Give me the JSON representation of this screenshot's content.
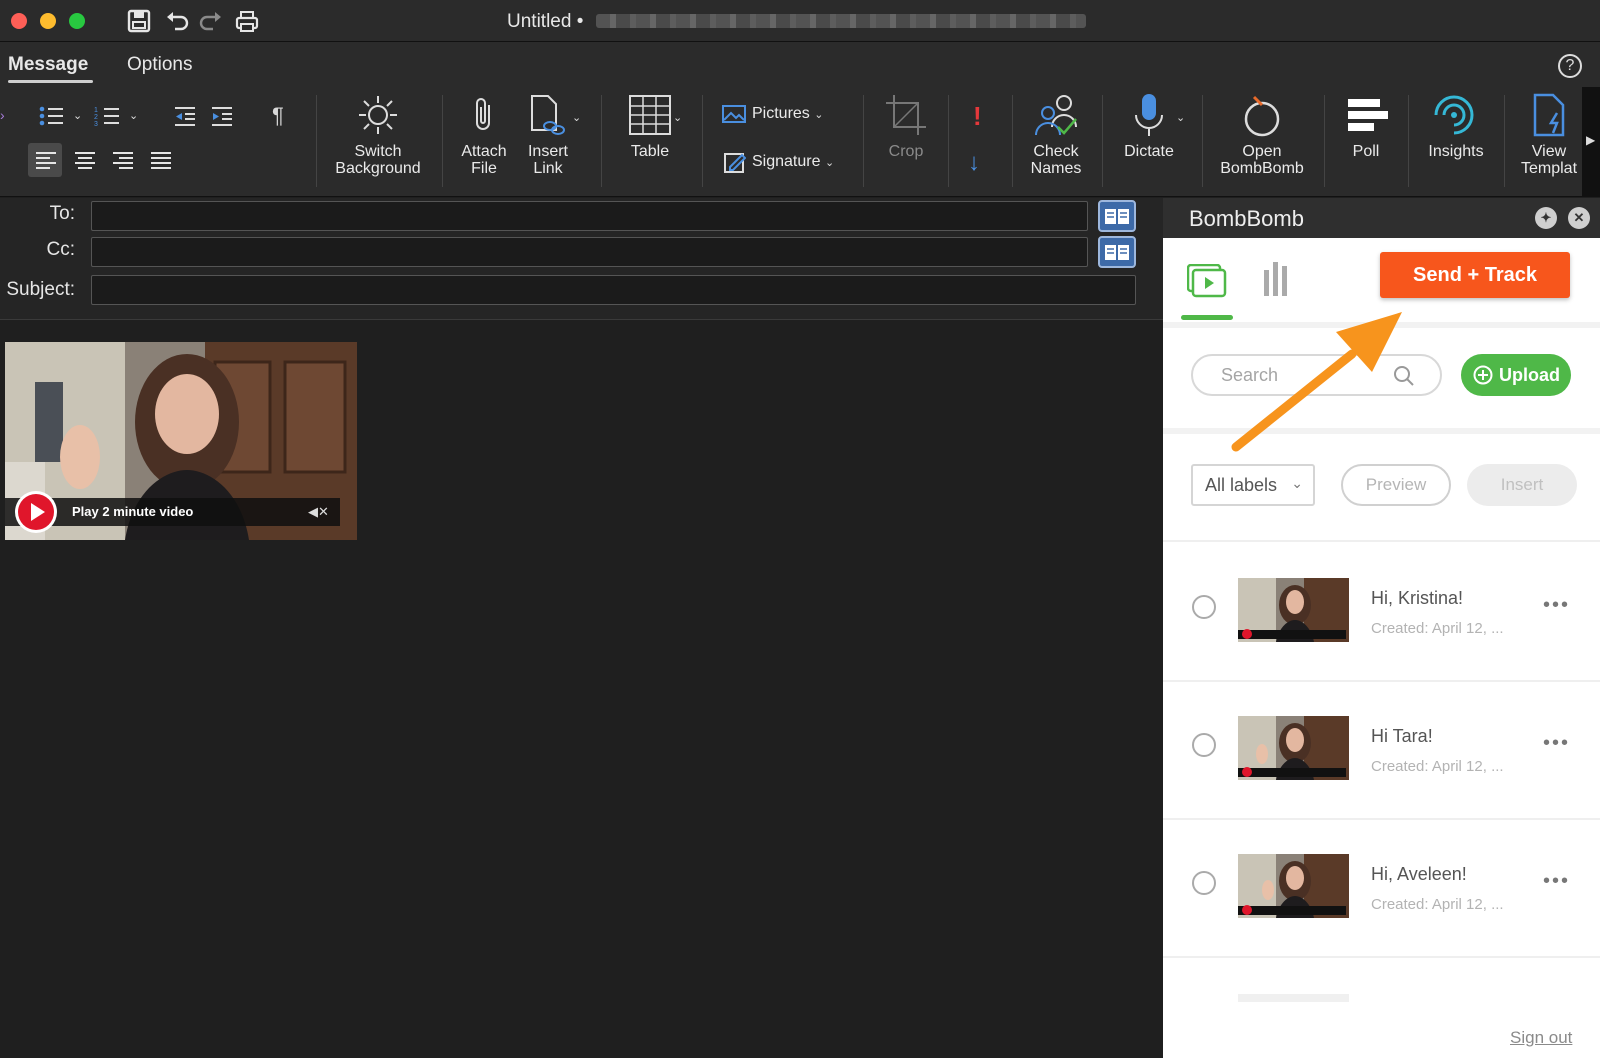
{
  "window": {
    "title": "Untitled •"
  },
  "ribbon_tabs": {
    "message": "Message",
    "options": "Options"
  },
  "ribbon": {
    "switch_background": [
      "Switch",
      "Background"
    ],
    "attach_file": [
      "Attach",
      "File"
    ],
    "insert_link": [
      "Insert",
      "Link"
    ],
    "table": "Table",
    "pictures": "Pictures",
    "signature": "Signature",
    "crop": "Crop",
    "check_names": [
      "Check",
      "Names"
    ],
    "dictate": "Dictate",
    "open_bombbomb": [
      "Open",
      "BombBomb"
    ],
    "poll": "Poll",
    "insights": "Insights",
    "view_templates": [
      "View",
      "Templat"
    ]
  },
  "fields": {
    "to_label": "To:",
    "cc_label": "Cc:",
    "subject_label": "Subject:"
  },
  "body": {
    "video_label": "Play 2 minute video"
  },
  "pane": {
    "title": "BombBomb",
    "send_track": "Send + Track",
    "search_placeholder": "Search",
    "upload": "Upload",
    "labels_select": "All labels",
    "preview": "Preview",
    "insert": "Insert",
    "videos": [
      {
        "title": "Hi, Kristina!",
        "date": "Created: April 12, ..."
      },
      {
        "title": "Hi Tara!",
        "date": "Created: April 12, ..."
      },
      {
        "title": "Hi, Aveleen!",
        "date": "Created: April 12, ..."
      }
    ],
    "sign_out": "Sign out"
  },
  "colors": {
    "accent_orange": "#f7561c",
    "accent_green": "#4fb848",
    "arrow": "#f7941d"
  }
}
